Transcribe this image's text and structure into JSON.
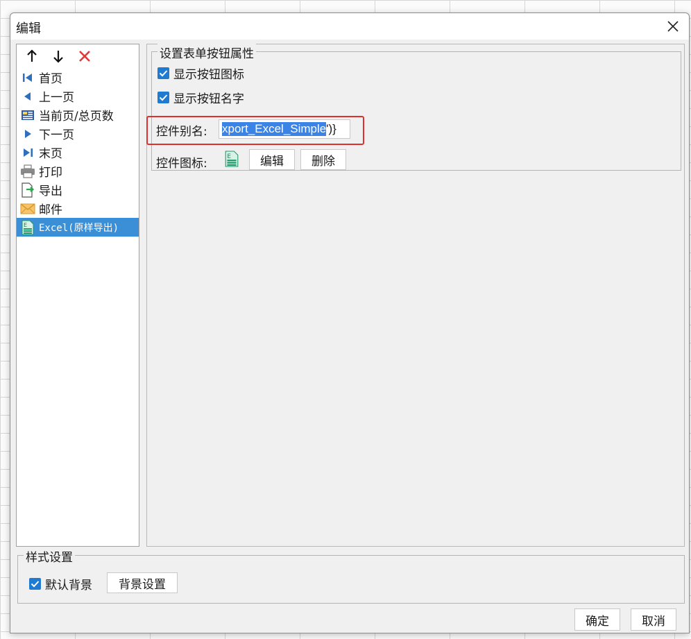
{
  "window": {
    "title": "编辑"
  },
  "list": {
    "items": [
      {
        "label": "首页",
        "icon": "first-page-icon"
      },
      {
        "label": "上一页",
        "icon": "prev-page-icon"
      },
      {
        "label": "当前页/总页数",
        "icon": "page-count-icon"
      },
      {
        "label": "下一页",
        "icon": "next-page-icon"
      },
      {
        "label": "末页",
        "icon": "last-page-icon"
      },
      {
        "label": "打印",
        "icon": "printer-icon"
      },
      {
        "label": "导出",
        "icon": "export-icon"
      },
      {
        "label": "邮件",
        "icon": "mail-icon"
      },
      {
        "label": "Excel(原样导出)",
        "icon": "excel-icon",
        "selected": true
      }
    ]
  },
  "form_props": {
    "legend": "设置表单按钮属性",
    "show_icon_label": "显示按钮图标",
    "show_icon_checked": true,
    "show_name_label": "显示按钮名字",
    "show_name_checked": true,
    "alias_label": "控件别名:",
    "alias_value_selected": "xport_Excel_Simple",
    "alias_value_rest": "')}",
    "icon_label": "控件图标:",
    "edit_button": "编辑",
    "delete_button": "删除"
  },
  "style_settings": {
    "legend": "样式设置",
    "default_bg_label": "默认背景",
    "default_bg_checked": true,
    "bg_settings_button": "背景设置"
  },
  "footer": {
    "ok_button": "确定",
    "cancel_button": "取消"
  },
  "colors": {
    "accent": "#1f7ad1",
    "selection": "#3b8fd6",
    "highlight": "#e0302d",
    "delete_red": "#e03a3a"
  }
}
